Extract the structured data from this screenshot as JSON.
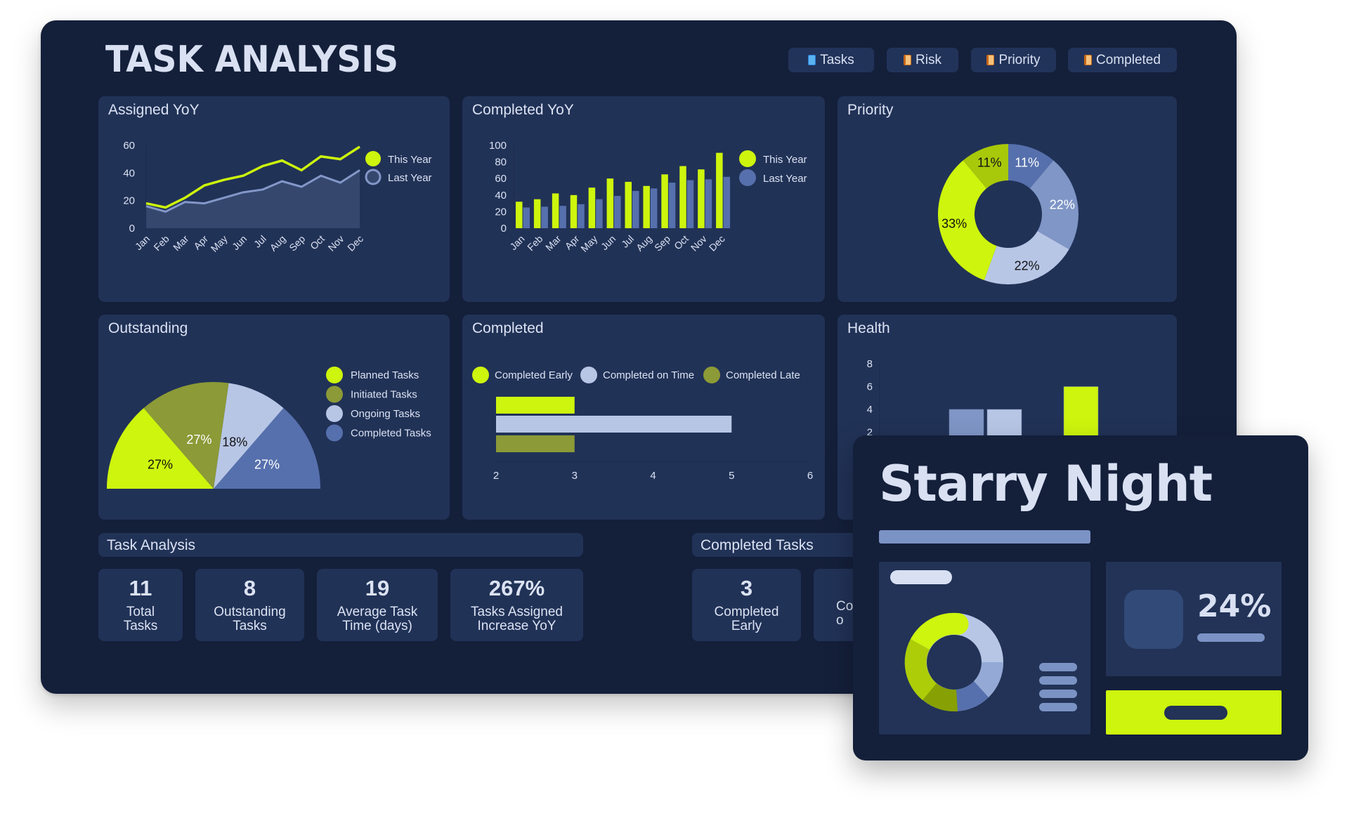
{
  "header": {
    "title": "TASK ANALYSIS",
    "tabs": [
      {
        "label": "Tasks",
        "icon": "document-icon"
      },
      {
        "label": "Risk",
        "icon": "notebook-icon"
      },
      {
        "label": "Priority",
        "icon": "notebook-icon"
      },
      {
        "label": "Completed",
        "icon": "notebook-icon"
      }
    ]
  },
  "colors": {
    "lime": "#cdf50d",
    "olive": "#8c9a37",
    "dark_lime": "#a8c80a",
    "light_blue": "#b8c6e6",
    "mid_blue": "#7f96c6",
    "blue": "#5670ad",
    "panel": "#141f3a",
    "card": "#213257"
  },
  "chart_data": [
    {
      "id": "assigned_yoy",
      "type": "area",
      "title": "Assigned YoY",
      "categories": [
        "Jan",
        "Feb",
        "Mar",
        "Apr",
        "May",
        "Jun",
        "Jul",
        "Aug",
        "Sep",
        "Oct",
        "Nov",
        "Dec"
      ],
      "series": [
        {
          "name": "This Year",
          "values": [
            18,
            15,
            22,
            31,
            35,
            38,
            45,
            49,
            42,
            52,
            50,
            59
          ]
        },
        {
          "name": "Last Year",
          "values": [
            16,
            12,
            19,
            18,
            22,
            26,
            28,
            34,
            30,
            38,
            33,
            42
          ]
        }
      ],
      "yticks": [
        "0",
        "20",
        "40",
        "60"
      ],
      "ylim": [
        0,
        60
      ],
      "legend": "right"
    },
    {
      "id": "completed_yoy",
      "type": "bar",
      "title": "Completed YoY",
      "categories": [
        "Jan",
        "Feb",
        "Mar",
        "Apr",
        "May",
        "Jun",
        "Jul",
        "Aug",
        "Sep",
        "Oct",
        "Nov",
        "Dec"
      ],
      "series": [
        {
          "name": "This Year",
          "values": [
            32,
            35,
            42,
            40,
            49,
            60,
            56,
            51,
            65,
            75,
            71,
            91
          ]
        },
        {
          "name": "Last Year",
          "values": [
            25,
            26,
            27,
            29,
            35,
            39,
            45,
            48,
            55,
            58,
            59,
            62
          ]
        }
      ],
      "yticks": [
        "0",
        "20",
        "40",
        "60",
        "80",
        "100"
      ],
      "ylim": [
        0,
        100
      ],
      "legend": "right"
    },
    {
      "id": "priority",
      "type": "pie",
      "title": "Priority",
      "donut": true,
      "slices": [
        {
          "label": "11%",
          "value": 11
        },
        {
          "label": "22%",
          "value": 22
        },
        {
          "label": "22%",
          "value": 22
        },
        {
          "label": "33%",
          "value": 33
        },
        {
          "label": "11%",
          "value": 11
        }
      ]
    },
    {
      "id": "outstanding",
      "type": "pie",
      "title": "Outstanding",
      "half": true,
      "slices": [
        {
          "name": "Planned Tasks",
          "label": "27%",
          "value": 27
        },
        {
          "name": "Initiated Tasks",
          "label": "27%",
          "value": 27
        },
        {
          "name": "Ongoing Tasks",
          "label": "18%",
          "value": 18
        },
        {
          "name": "Completed Tasks",
          "label": "27%",
          "value": 27
        }
      ],
      "legend": "right"
    },
    {
      "id": "completed",
      "type": "bar",
      "orientation": "horizontal",
      "title": "Completed",
      "series": [
        {
          "name": "Completed Early",
          "value": 3
        },
        {
          "name": "Completed on Time",
          "value": 5
        },
        {
          "name": "Completed Late",
          "value": 3
        }
      ],
      "xticks": [
        "2",
        "3",
        "4",
        "5",
        "6"
      ],
      "xlim": [
        2,
        6
      ],
      "legend": "top"
    },
    {
      "id": "health",
      "type": "bar",
      "title": "Health",
      "values": [
        4,
        4,
        6
      ],
      "yticks": [
        "2",
        "4",
        "6",
        "8"
      ],
      "ylim": [
        0,
        8
      ]
    }
  ],
  "task_analysis": {
    "title": "Task Analysis",
    "kpis": [
      {
        "value": "11",
        "label": "Total\nTasks"
      },
      {
        "value": "8",
        "label": "Outstanding\nTasks"
      },
      {
        "value": "19",
        "label": "Average Task\nTime (days)"
      },
      {
        "value": "267%",
        "label": "Tasks Assigned\nIncrease YoY"
      }
    ]
  },
  "completed_tasks": {
    "title": "Completed Tasks",
    "kpis": [
      {
        "value": "3",
        "label": "Completed\nEarly"
      },
      {
        "value": "",
        "label": "Co\no"
      }
    ]
  },
  "starry_night": {
    "title": "Starry Night",
    "percent": "24%"
  }
}
